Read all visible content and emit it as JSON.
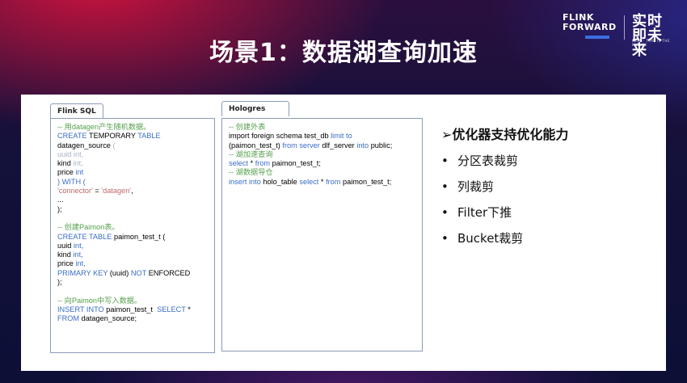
{
  "title": "场景1：数据湖查询加速",
  "logo": {
    "line1": "FLINK",
    "line2": "FORWARD",
    "cn": "实时即未来",
    "sub": "REAL · TIME IS THE FUTURE"
  },
  "flink_panel": {
    "tab": "Flink SQL",
    "lines": [
      [
        {
          "t": "-- 用datagen产生随机数据。",
          "c": "c"
        }
      ],
      [
        {
          "t": "CREATE ",
          "c": "k"
        },
        {
          "t": "TEMPORARY ",
          "c": ""
        },
        {
          "t": "TABLE",
          "c": "k"
        }
      ],
      [
        {
          "t": "datagen_source ",
          "c": ""
        },
        {
          "t": "(",
          "c": "g"
        }
      ],
      [
        {
          "t": "uuid int,",
          "c": "g"
        }
      ],
      [
        {
          "t": "kind ",
          "c": ""
        },
        {
          "t": "int,",
          "c": "g"
        }
      ],
      [
        {
          "t": "price ",
          "c": ""
        },
        {
          "t": "int",
          "c": "k"
        }
      ],
      [
        {
          "t": ") WITH (",
          "c": "k"
        }
      ],
      [
        {
          "t": "'connector'",
          "c": "s"
        },
        {
          "t": " = ",
          "c": ""
        },
        {
          "t": "'datagen'",
          "c": "s"
        },
        {
          "t": ",",
          "c": ""
        }
      ],
      [
        {
          "t": "...",
          "c": ""
        }
      ],
      [
        {
          "t": ");",
          "c": ""
        }
      ],
      [
        {
          "t": "",
          "c": ""
        }
      ],
      [
        {
          "t": "-- 创建Paimon表。",
          "c": "c"
        }
      ],
      [
        {
          "t": "CREATE TABLE ",
          "c": "k"
        },
        {
          "t": "paimon_test_t (",
          "c": ""
        }
      ],
      [
        {
          "t": "uuid ",
          "c": ""
        },
        {
          "t": "int,",
          "c": "k"
        }
      ],
      [
        {
          "t": "kind ",
          "c": ""
        },
        {
          "t": "int,",
          "c": "k"
        }
      ],
      [
        {
          "t": "price ",
          "c": ""
        },
        {
          "t": "int,",
          "c": "k"
        }
      ],
      [
        {
          "t": "PRIMARY KEY ",
          "c": "k"
        },
        {
          "t": "(uuid) ",
          "c": ""
        },
        {
          "t": "NOT ",
          "c": "k"
        },
        {
          "t": "ENFORCED",
          "c": ""
        }
      ],
      [
        {
          "t": ");",
          "c": ""
        }
      ],
      [
        {
          "t": "",
          "c": ""
        }
      ],
      [
        {
          "t": "-- 向Paimon中写入数据。",
          "c": "c"
        }
      ],
      [
        {
          "t": "INSERT INTO ",
          "c": "k"
        },
        {
          "t": "paimon_test_t  ",
          "c": ""
        },
        {
          "t": "SELECT ",
          "c": "k"
        },
        {
          "t": "*",
          "c": ""
        }
      ],
      [
        {
          "t": "FROM ",
          "c": "k"
        },
        {
          "t": "datagen_source;",
          "c": ""
        }
      ]
    ]
  },
  "hologres_panel": {
    "tab": "Hologres SQL",
    "lines": [
      [
        {
          "t": "-- 创建外表",
          "c": "c"
        }
      ],
      [
        {
          "t": "import foreign schema test_db ",
          "c": ""
        },
        {
          "t": "limit to",
          "c": "k"
        }
      ],
      [
        {
          "t": "(paimon_test_t) ",
          "c": ""
        },
        {
          "t": "from server ",
          "c": "k"
        },
        {
          "t": "dlf_server ",
          "c": ""
        },
        {
          "t": "into ",
          "c": "k"
        },
        {
          "t": "public;",
          "c": ""
        }
      ],
      [
        {
          "t": "-- 湖加速查询",
          "c": "c"
        }
      ],
      [
        {
          "t": "select ",
          "c": "k"
        },
        {
          "t": "* ",
          "c": ""
        },
        {
          "t": "from ",
          "c": "k"
        },
        {
          "t": "paimon_test_t;",
          "c": ""
        }
      ],
      [
        {
          "t": "-- 湖数据导仓",
          "c": "c"
        }
      ],
      [
        {
          "t": "insert into ",
          "c": "k"
        },
        {
          "t": "holo_table ",
          "c": ""
        },
        {
          "t": "select ",
          "c": "k"
        },
        {
          "t": "* ",
          "c": ""
        },
        {
          "t": "from ",
          "c": "k"
        },
        {
          "t": "paimon_test_t;",
          "c": ""
        }
      ]
    ]
  },
  "bullets": {
    "head_marker": "➢",
    "head": "优化器支持优化能力",
    "items": [
      "分区表裁剪",
      "列裁剪",
      "Filter下推",
      "Bucket裁剪"
    ]
  },
  "colors": {
    "comment": "#55a04b",
    "keyword": "#3a6ec8",
    "string": "#c06a6a",
    "faded": "#a7b3c8"
  }
}
